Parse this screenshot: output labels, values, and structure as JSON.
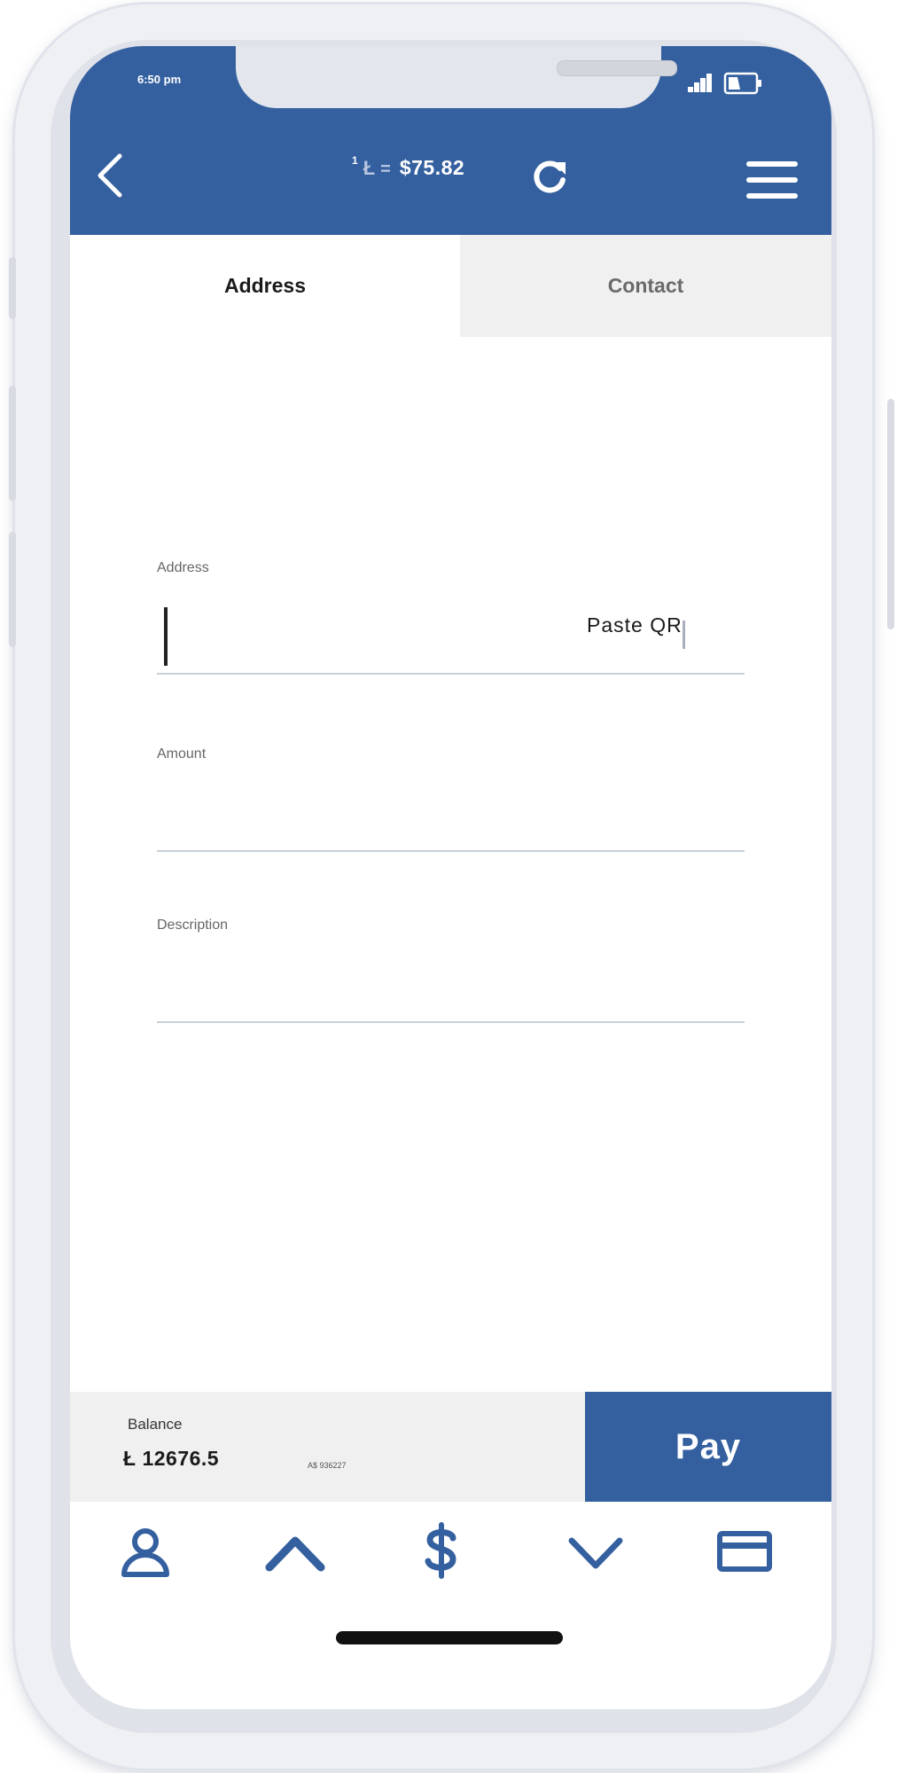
{
  "status_bar": {
    "time": "6:50 pm",
    "icons": [
      "signal-icon",
      "battery-icon"
    ]
  },
  "header": {
    "rate_unit": "1",
    "rate_coin": "Ł",
    "rate_eq": "=",
    "rate_value": "$75.82",
    "icons": [
      "chevron-left-icon",
      "refresh-icon",
      "hamburger-menu-icon"
    ]
  },
  "tabs": [
    {
      "label": "Address",
      "active": true
    },
    {
      "label": "Contact",
      "active": false
    }
  ],
  "form": {
    "address_label": "Address",
    "address_value": "",
    "paste_qr_label": "Paste  QR",
    "amount_label": "Amount",
    "amount_value": "",
    "description_label": "Description",
    "description_value": ""
  },
  "footer": {
    "balance_label": "Balance",
    "balance_value": "Ł 12676.5",
    "balance_code": "A$ 936227",
    "pay_label": "Pay"
  },
  "bottom_nav": [
    "user-icon",
    "chevron-up-icon",
    "dollar-icon",
    "chevron-down-icon",
    "card-icon"
  ],
  "colors": {
    "brand": "#3460a0",
    "tab_inactive_bg": "#f0f0f0",
    "panel_bg": "#f0f0f0"
  }
}
